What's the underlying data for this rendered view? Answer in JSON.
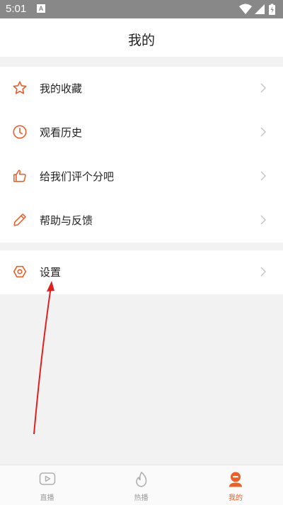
{
  "status_bar": {
    "time": "5:01",
    "notification_letter": "A"
  },
  "header": {
    "title": "我的"
  },
  "menu_group_1": [
    {
      "label": "我的收藏",
      "icon": "star-icon"
    },
    {
      "label": "观看历史",
      "icon": "clock-icon"
    },
    {
      "label": "给我们评个分吧",
      "icon": "thumbs-up-icon"
    },
    {
      "label": "帮助与反馈",
      "icon": "pencil-icon"
    }
  ],
  "menu_group_2": [
    {
      "label": "设置",
      "icon": "settings-icon"
    }
  ],
  "tabs": [
    {
      "label": "直播",
      "icon": "play-icon",
      "active": false
    },
    {
      "label": "热播",
      "icon": "flame-icon",
      "active": false
    },
    {
      "label": "我的",
      "icon": "person-icon",
      "active": true
    }
  ],
  "colors": {
    "accent": "#e9602b",
    "background": "#f2f2f2",
    "status_bar": "#888888",
    "annotation_arrow": "#e02020"
  }
}
